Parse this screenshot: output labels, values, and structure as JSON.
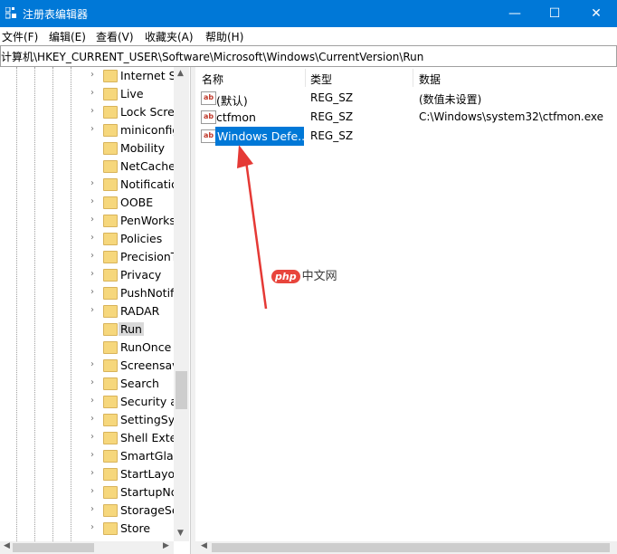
{
  "window": {
    "title": "注册表编辑器",
    "controls": {
      "minimize": "—",
      "maximize": "☐",
      "close": "✕"
    },
    "titlebar_color": "#0078d7"
  },
  "menu": [
    {
      "label": "文件(F)"
    },
    {
      "label": "编辑(E)"
    },
    {
      "label": "查看(V)"
    },
    {
      "label": "收藏夹(A)"
    },
    {
      "label": "帮助(H)"
    }
  ],
  "address": "计算机\\HKEY_CURRENT_USER\\Software\\Microsoft\\Windows\\CurrentVersion\\Run",
  "tree": {
    "items": [
      {
        "label": "Internet Se",
        "expandable": true
      },
      {
        "label": "Live",
        "expandable": true
      },
      {
        "label": "Lock Scree",
        "expandable": true
      },
      {
        "label": "miniconfig",
        "expandable": true
      },
      {
        "label": "Mobility",
        "expandable": false
      },
      {
        "label": "NetCache",
        "expandable": false
      },
      {
        "label": "Notificatio",
        "expandable": true
      },
      {
        "label": "OOBE",
        "expandable": true
      },
      {
        "label": "PenWorks",
        "expandable": true
      },
      {
        "label": "Policies",
        "expandable": true
      },
      {
        "label": "PrecisionT",
        "expandable": true
      },
      {
        "label": "Privacy",
        "expandable": true
      },
      {
        "label": "PushNotifi",
        "expandable": true
      },
      {
        "label": "RADAR",
        "expandable": true
      },
      {
        "label": "Run",
        "expandable": false,
        "selected": true
      },
      {
        "label": "RunOnce",
        "expandable": false
      },
      {
        "label": "Screensav",
        "expandable": true
      },
      {
        "label": "Search",
        "expandable": true
      },
      {
        "label": "Security ar",
        "expandable": true
      },
      {
        "label": "SettingSyn",
        "expandable": true
      },
      {
        "label": "Shell Exter",
        "expandable": true
      },
      {
        "label": "SmartGlas",
        "expandable": true
      },
      {
        "label": "StartLayou",
        "expandable": true
      },
      {
        "label": "StartupNo",
        "expandable": true
      },
      {
        "label": "StorageSe",
        "expandable": true
      },
      {
        "label": "Store",
        "expandable": true
      }
    ]
  },
  "list": {
    "columns": {
      "name": "名称",
      "type": "类型",
      "data": "数据"
    },
    "rows": [
      {
        "name": "(默认)",
        "type": "REG_SZ",
        "data": "(数值未设置)",
        "icon": "ab"
      },
      {
        "name": "ctfmon",
        "type": "REG_SZ",
        "data": "C:\\Windows\\system32\\ctfmon.exe",
        "icon": "ab"
      },
      {
        "name": "Windows Defe...",
        "type": "REG_SZ",
        "data": "",
        "icon": "ab",
        "selected": true
      }
    ]
  },
  "watermark": {
    "logo": "php",
    "text": "中文网"
  },
  "annotation": {
    "arrow_color": "#e53935"
  }
}
